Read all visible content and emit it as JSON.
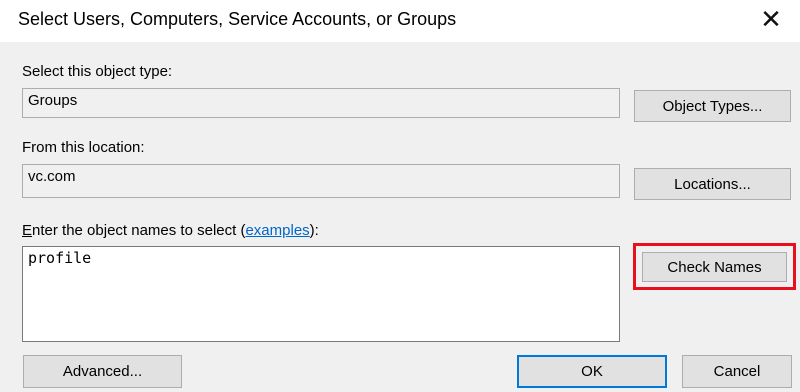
{
  "dialog": {
    "title": "Select Users, Computers, Service Accounts, or Groups",
    "close_glyph": "✕"
  },
  "object_type": {
    "label": "Select this object type:",
    "value": "Groups",
    "button_label": "Object Types..."
  },
  "location": {
    "label": "From this location:",
    "value": "vc.com",
    "button_label": "Locations..."
  },
  "object_names": {
    "label_accel": "E",
    "label_rest": "nter the object names to select (",
    "link_text": "examples",
    "label_suffix": "):",
    "value": "profile",
    "check_button_label": "Check Names",
    "highlight_color": "#e8101e"
  },
  "footer": {
    "advanced_label": "Advanced...",
    "ok_label": "OK",
    "cancel_label": "Cancel"
  },
  "colors": {
    "background": "#f0f0f0",
    "title_bar": "#ffffff",
    "default_button_border": "#0078d7",
    "link": "#0066cc"
  }
}
